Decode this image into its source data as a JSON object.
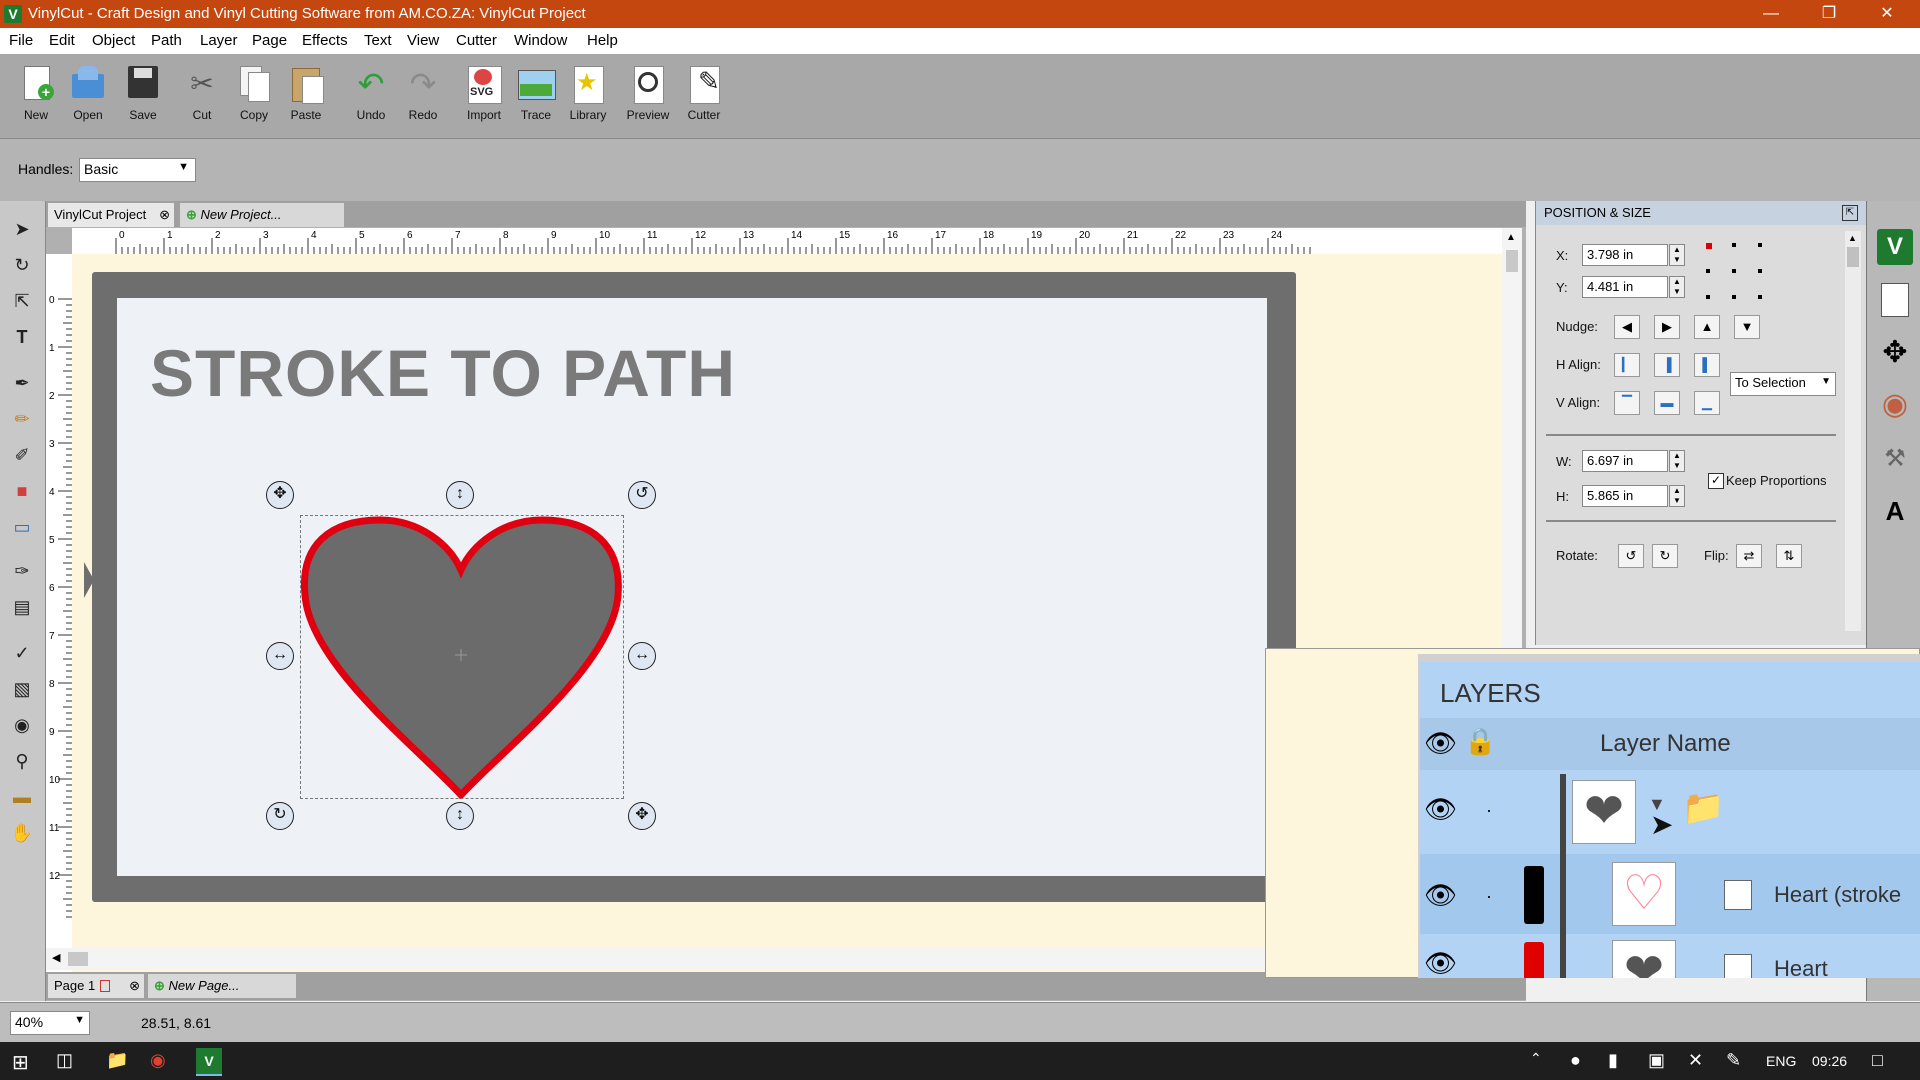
{
  "window": {
    "title": "VinylCut - Craft Design and Vinyl Cutting Software from AM.CO.ZA: VinylCut Project",
    "app_icon": "V"
  },
  "menu": [
    "File",
    "Edit",
    "Object",
    "Path",
    "Layer",
    "Page",
    "Effects",
    "Text",
    "View",
    "Cutter",
    "Window",
    "Help"
  ],
  "toolbar": [
    "New",
    "Open",
    "Save",
    "Cut",
    "Copy",
    "Paste",
    "Undo",
    "Redo",
    "Import",
    "Trace",
    "Library",
    "Preview",
    "Cutter"
  ],
  "import_icon_text": "SVG",
  "handles": {
    "label": "Handles:",
    "value": "Basic"
  },
  "tabs": {
    "active": "VinylCut Project",
    "new": "New Project..."
  },
  "ruler_h": [
    "0",
    "1",
    "2",
    "3",
    "4",
    "5",
    "6",
    "7",
    "8",
    "9",
    "10",
    "11",
    "12",
    "13",
    "14",
    "15",
    "16",
    "17",
    "18",
    "19",
    "20",
    "21",
    "22",
    "23",
    "24"
  ],
  "ruler_v": [
    "0",
    "1",
    "2",
    "3",
    "4",
    "5",
    "6",
    "7",
    "8",
    "9",
    "10",
    "11",
    "12"
  ],
  "canvas": {
    "heading": "STROKE TO PATH"
  },
  "page_tabs": {
    "active": "Page 1",
    "new": "New Page..."
  },
  "status": {
    "zoom": "40%",
    "coords": "28.51, 8.61"
  },
  "position_size": {
    "title": "POSITION & SIZE",
    "x_label": "X:",
    "x": "3.798 in",
    "y_label": "Y:",
    "y": "4.481 in",
    "nudge_label": "Nudge:",
    "halign_label": "H Align:",
    "valign_label": "V Align:",
    "align_target": "To Selection",
    "w_label": "W:",
    "w": "6.697 in",
    "h_label": "H:",
    "h": "5.865 in",
    "keep_proportions": "Keep Proportions",
    "rotate_label": "Rotate:",
    "flip_label": "Flip:"
  },
  "layers": {
    "title": "LAYERS",
    "column": "Layer Name",
    "rows": [
      {
        "name": "",
        "color": "#000000"
      },
      {
        "name": "Heart (stroke",
        "color": "#000000"
      },
      {
        "name": "Heart",
        "color": "#e00000"
      }
    ]
  },
  "taskbar": {
    "language": "ENG",
    "time": "09:26"
  },
  "colors": {
    "title_bar": "#c4470f",
    "heart_fill": "#6b6b6b",
    "heart_stroke": "#e00010",
    "canvas_bg": "#fdf6dd"
  }
}
